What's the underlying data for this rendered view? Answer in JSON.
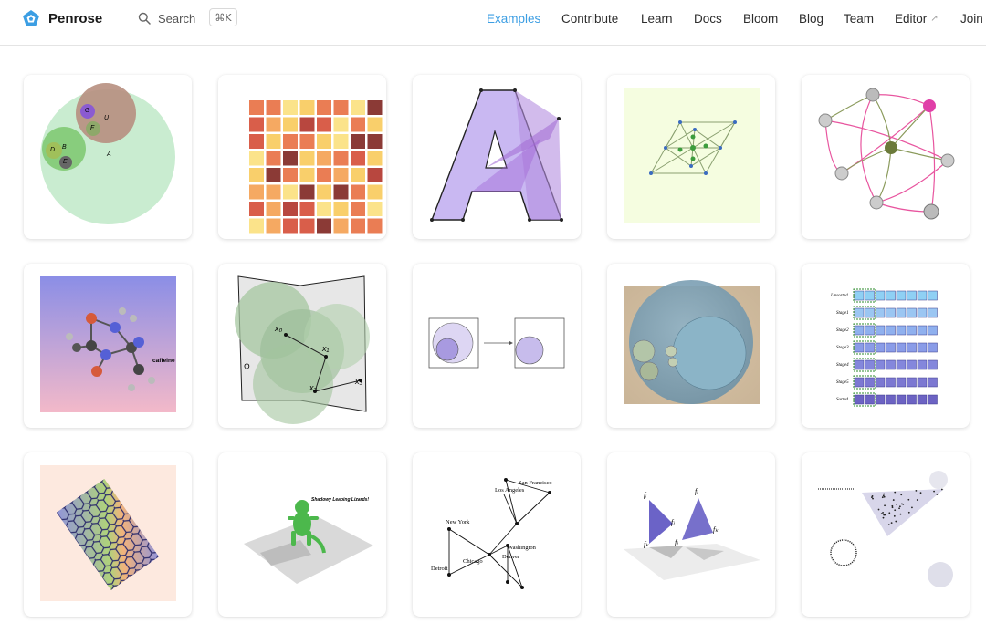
{
  "header": {
    "logo_text": "Penrose",
    "search_label": "Search",
    "search_shortcut": "⌘K",
    "nav": [
      {
        "label": "Examples",
        "active": true
      },
      {
        "label": "Contribute"
      },
      {
        "label": "Learn"
      },
      {
        "label": "Docs"
      },
      {
        "label": "Bloom"
      },
      {
        "label": "Blog"
      },
      {
        "label": "Team"
      },
      {
        "label": "Editor",
        "external": true
      },
      {
        "label": "Join"
      }
    ],
    "accent_color": "#3c9ee3",
    "logo_color": "#3c9ee3"
  },
  "gallery": {
    "caffeine_label": "caffeine",
    "lizard_caption": "Shadowy Leaping Lizards!",
    "venn_labels": [
      "G",
      "U",
      "F",
      "D",
      "B",
      "E",
      "A"
    ],
    "surface_labels": [
      "x₀",
      "x₁",
      "x₂",
      "x₃",
      "Ω"
    ],
    "cities": [
      "San Francisco",
      "Los Angeles",
      "New York",
      "Washington",
      "Denver",
      "Chicago",
      "Detroit"
    ],
    "vector_labels": [
      "fᵢ",
      "fⱼ",
      "fₖ",
      "fᵢ",
      "fⱼ",
      "fₖ"
    ],
    "array_row_labels": [
      "Unsorted",
      "Stage1",
      "Stage2",
      "Stage3",
      "Stage4",
      "Stage5",
      "Sorted"
    ]
  }
}
